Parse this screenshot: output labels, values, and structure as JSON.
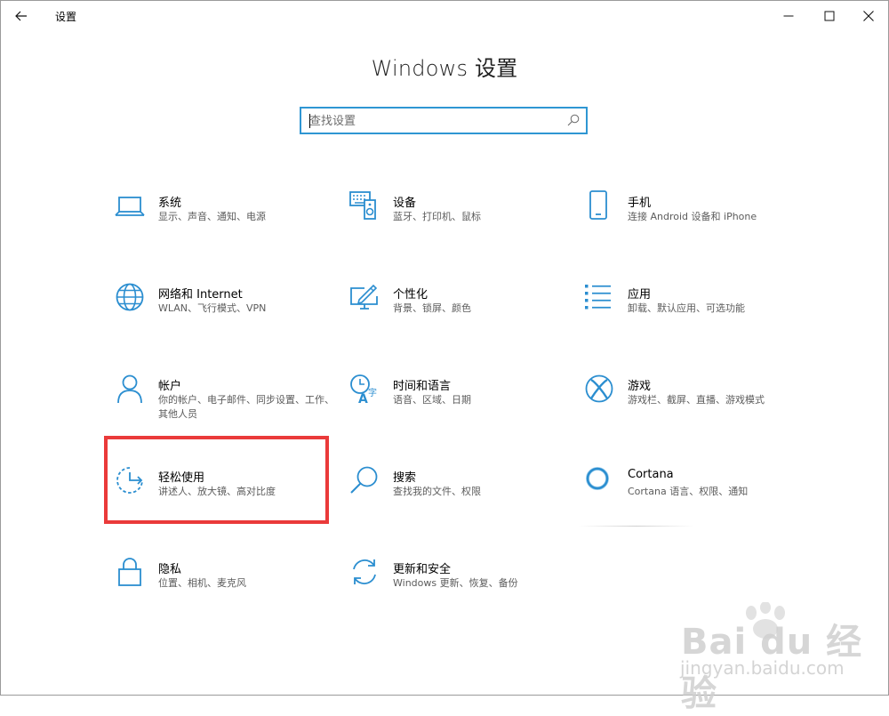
{
  "window": {
    "title": "设置"
  },
  "header": {
    "title": "Windows 设置"
  },
  "search": {
    "placeholder": "查找设置",
    "value": ""
  },
  "tiles": [
    {
      "icon": "laptop-icon",
      "title": "系统",
      "desc": "显示、声音、通知、电源"
    },
    {
      "icon": "keyboard-speaker-icon",
      "title": "设备",
      "desc": "蓝牙、打印机、鼠标"
    },
    {
      "icon": "phone-icon",
      "title": "手机",
      "desc": "连接 Android 设备和 iPhone"
    },
    {
      "icon": "globe-icon",
      "title": "网络和 Internet",
      "desc": "WLAN、飞行模式、VPN"
    },
    {
      "icon": "paint-monitor-icon",
      "title": "个性化",
      "desc": "背景、锁屏、颜色"
    },
    {
      "icon": "app-list-icon",
      "title": "应用",
      "desc": "卸载、默认应用、可选功能"
    },
    {
      "icon": "person-icon",
      "title": "帐户",
      "desc": "你的帐户、电子邮件、同步设置、工作、其他人员"
    },
    {
      "icon": "clock-language-icon",
      "title": "时间和语言",
      "desc": "语音、区域、日期"
    },
    {
      "icon": "xbox-icon",
      "title": "游戏",
      "desc": "游戏栏、截屏、直播、游戏模式"
    },
    {
      "icon": "ease-of-access-icon",
      "title": "轻松使用",
      "desc": "讲述人、放大镜、高对比度"
    },
    {
      "icon": "magnifier-icon",
      "title": "搜索",
      "desc": "查找我的文件、权限"
    },
    {
      "icon": "cortana-ring-icon",
      "title": "Cortana",
      "desc": "Cortana 语言、权限、通知"
    },
    {
      "icon": "lock-icon",
      "title": "隐私",
      "desc": "位置、相机、麦克风"
    },
    {
      "icon": "sync-arrows-icon",
      "title": "更新和安全",
      "desc": "Windows 更新、恢复、备份"
    }
  ],
  "colors": {
    "accent": "#2b8ed0",
    "highlight_box": "#ea3a3a"
  },
  "watermark": {
    "brand": "Bai du 经验",
    "url": "jingyan.baidu.com"
  }
}
